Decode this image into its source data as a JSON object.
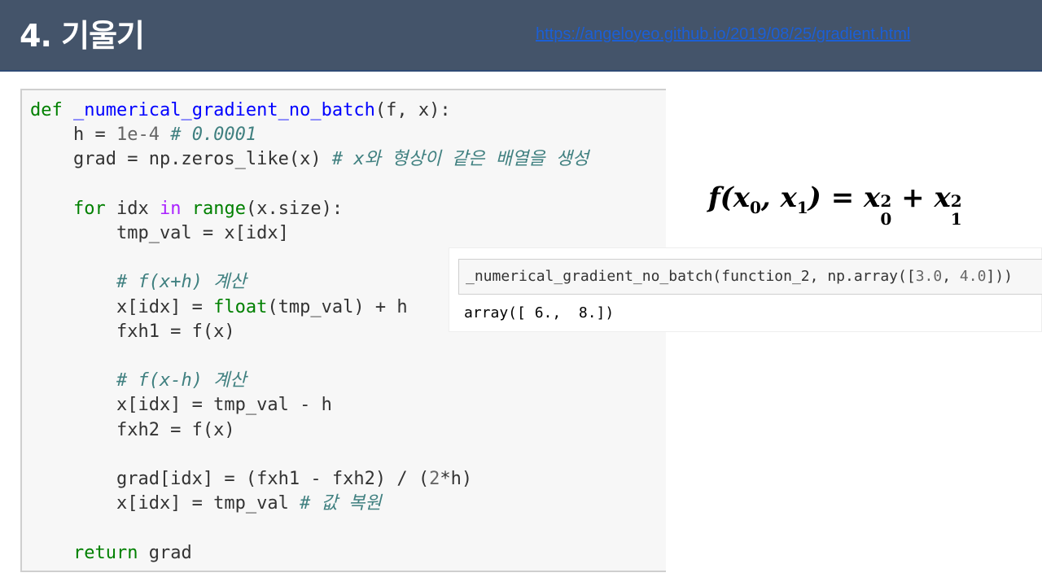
{
  "header": {
    "title": "4. 기울기",
    "link": "https://angeloyeo.github.io/2019/08/25/gradient.html"
  },
  "code": {
    "def_kw": "def",
    "func_name": "_numerical_gradient_no_batch",
    "params": "(f, x):",
    "line_h_code": "    h = ",
    "line_h_num": "1e-4",
    "line_h_comment": "# 0.0001",
    "line_grad_code": "    grad = np.zeros_like(x) ",
    "line_grad_comment": "# x와 형상이 같은 배열을 생성",
    "for_kw": "for",
    "for_var": " idx ",
    "in_kw": "in",
    "range_fn": "range",
    "for_rest": "(x.size):",
    "tmp_val_line": "        tmp_val = x[idx]",
    "comment_plus": "# f(x+h) 계산",
    "float_prefix": "        x[idx] = ",
    "float_fn": "float",
    "float_rest": "(tmp_val) + h",
    "fxh1_line": "        fxh1 = f(x)",
    "comment_minus": "# f(x-h) 계산",
    "minus_line": "        x[idx] = tmp_val - h",
    "fxh2_line": "        fxh2 = f(x)",
    "grad_line_a": "        grad[idx] = (fxh1 - fxh2) / (",
    "grad_line_num": "2",
    "grad_line_b": "*h)",
    "restore_code": "        x[idx] = tmp_val ",
    "restore_comment": "# 값 복원",
    "return_kw": "return",
    "return_rest": " grad"
  },
  "formula": {
    "lhs": "f(x",
    "sub0": "0",
    "comma": ", x",
    "sub1": "1",
    "rhs_a": ") = x",
    "plus": " + x",
    "exp": "2"
  },
  "cell": {
    "input_prefix": "_numerical_gradient_no_batch(function_2, np.array([",
    "input_n1": "3.0",
    "input_sep": ", ",
    "input_n2": "4.0",
    "input_suffix": "]))",
    "output": "array([ 6.,  8.])"
  },
  "colors": {
    "header_bg": "#44546a",
    "keyword": "#008000",
    "function": "#0000ff",
    "comment": "#408080",
    "in_keyword": "#aa22ff",
    "link": "#1b5fd6"
  }
}
